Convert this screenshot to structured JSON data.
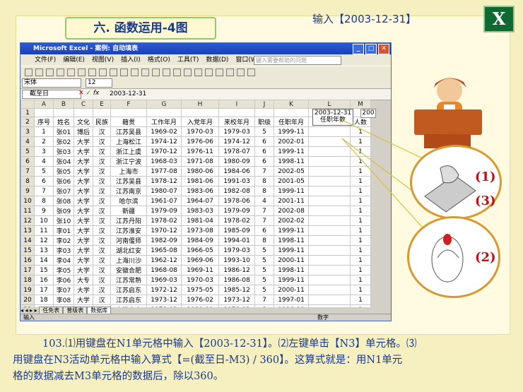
{
  "slide": {
    "title": "六. 函数运用-4图",
    "subtitle": "输入【2003-12-31】",
    "excel_logo": "X"
  },
  "excel": {
    "window_title": "Microsoft Excel - 案例: 自动填表",
    "menu": [
      "文件(F)",
      "编辑(E)",
      "视图(V)",
      "插入(I)",
      "格式(O)",
      "工具(T)",
      "数据(D)",
      "窗口(W)",
      "帮助(H)"
    ],
    "help_placeholder": "键入需要帮助的问题",
    "font_name": "宋体",
    "font_size": "12",
    "name_box": "截至日",
    "formula_value": "2003-12-31",
    "column_headers": [
      "",
      "A",
      "B",
      "C",
      "E",
      "F",
      "G",
      "H",
      "I",
      "J",
      "K",
      "L",
      "M",
      "N",
      "O"
    ],
    "header_row": [
      "序号",
      "姓名",
      "文化",
      "民族",
      "籍贯",
      "工作年月",
      "入党年月",
      "来校年月",
      "职级",
      "任职年月",
      "任职年数",
      "人数"
    ],
    "rows": [
      [
        "1",
        "张01",
        "博后",
        "汉",
        "江苏吴县",
        "1969-02",
        "1970-03",
        "1979-03",
        "5",
        "1999-11",
        "",
        "1"
      ],
      [
        "2",
        "张02",
        "大学",
        "汉",
        "上海松江",
        "1974-12",
        "1976-06",
        "1974-12",
        "6",
        "2002-01",
        "",
        "1"
      ],
      [
        "3",
        "张03",
        "大学",
        "汉",
        "浙江上虞",
        "1970-12",
        "1976-11",
        "1978-07",
        "6",
        "1999-11",
        "",
        "1"
      ],
      [
        "4",
        "张04",
        "大学",
        "汉",
        "浙江宁波",
        "1968-03",
        "1971-08",
        "1980-09",
        "6",
        "1998-11",
        "",
        "1"
      ],
      [
        "5",
        "张05",
        "大学",
        "汉",
        "上海市",
        "1977-08",
        "1980-06",
        "1984-06",
        "7",
        "2002-05",
        "",
        "1"
      ],
      [
        "6",
        "张06",
        "大学",
        "汉",
        "江苏吴县",
        "1978-12",
        "1981-06",
        "1991-03",
        "8",
        "2001-05",
        "",
        "1"
      ],
      [
        "7",
        "张07",
        "大学",
        "汉",
        "江苏南京",
        "1980-07",
        "1983-06",
        "1982-08",
        "8",
        "1999-11",
        "",
        "1"
      ],
      [
        "8",
        "张08",
        "大学",
        "汉",
        "哈尔滨",
        "1961-07",
        "1964-07",
        "1978-06",
        "4",
        "2001-11",
        "",
        "1"
      ],
      [
        "9",
        "张09",
        "大学",
        "汉",
        "新疆",
        "1979-09",
        "1983-03",
        "1979-09",
        "7",
        "2002-08",
        "",
        "1"
      ],
      [
        "10",
        "张10",
        "大学",
        "汉",
        "江苏丹阳",
        "1978-02",
        "1981-04",
        "1978-02",
        "7",
        "2002-02",
        "",
        "1"
      ],
      [
        "11",
        "李01",
        "大学",
        "汉",
        "江苏淮安",
        "1970-12",
        "1973-08",
        "1985-09",
        "6",
        "1999-11",
        "",
        "1"
      ],
      [
        "12",
        "李02",
        "大学",
        "汉",
        "河南偃师",
        "1982-09",
        "1984-09",
        "1994-01",
        "8",
        "1998-11",
        "",
        "1"
      ],
      [
        "13",
        "李03",
        "大学",
        "汉",
        "湖北红安",
        "1965-08",
        "1966-05",
        "1979-03",
        "5",
        "1999-11",
        "",
        "1"
      ],
      [
        "14",
        "李04",
        "大学",
        "汉",
        "上海川沙",
        "1962-12",
        "1969-06",
        "1993-10",
        "5",
        "2000-11",
        "",
        "1"
      ],
      [
        "15",
        "李05",
        "大学",
        "汉",
        "安徽合肥",
        "1968-08",
        "1969-11",
        "1986-12",
        "5",
        "1998-11",
        "",
        "1"
      ],
      [
        "16",
        "李06",
        "大专",
        "汉",
        "江苏常熟",
        "1969-03",
        "1970-03",
        "1986-08",
        "5",
        "1999-11",
        "",
        "1"
      ],
      [
        "17",
        "李07",
        "大学",
        "汉",
        "江苏启东",
        "1972-12",
        "1975-05",
        "1985-12",
        "5",
        "2000-11",
        "",
        "1"
      ],
      [
        "18",
        "李08",
        "大学",
        "汉",
        "江苏启东",
        "1973-12",
        "1976-02",
        "1973-12",
        "7",
        "1997-01",
        "",
        "1"
      ],
      [
        "19",
        "李09",
        "大专",
        "汉",
        "安徽安庆",
        "1978-02",
        "1980-01",
        "1978-02",
        "8",
        "1998-11",
        "",
        "1"
      ],
      [
        "20",
        "李10",
        "大学",
        "汉",
        "安徽巢湖",
        "1979-11",
        "1984-12",
        "1979-11",
        "8",
        "2001-02",
        "",
        "1"
      ]
    ],
    "row1_n": "2003-12-31",
    "row1_o": "200",
    "sheet_tabs": [
      "任免表",
      "普级表",
      "数据库"
    ],
    "active_sheet": "数据库",
    "status_left": "输入",
    "status_right": "数字"
  },
  "labels": {
    "keyboard_1": "(1)",
    "keyboard_3": "(3)",
    "mouse_2": "(2)"
  },
  "caption": {
    "line1": "103.⑴用键盘在N1单元格中输入【2003-12-31】。⑵左键单击【N3】单元格。⑶",
    "line2": "用键盘在N3活动单元格中输入算式【=(截至日-M3) / 360】。这算式就是：用N1单元",
    "line3": "格的数据减去M3单元格的数据后，除以360。"
  }
}
